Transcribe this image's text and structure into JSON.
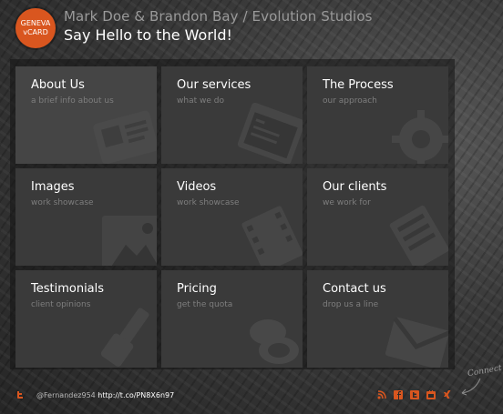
{
  "brand": {
    "logo_line1": "GENEVA",
    "logo_line2": "vCARD",
    "accent": "#d9561f"
  },
  "header": {
    "title": "Mark Doe & Brandon Bay / Evolution Studios",
    "subtitle": "Say Hello to the World!"
  },
  "tiles": [
    {
      "title": "About Us",
      "subtitle": "a brief info about us",
      "icon": "id-card-icon"
    },
    {
      "title": "Our services",
      "subtitle": "what we do",
      "icon": "browser-window-icon"
    },
    {
      "title": "The Process",
      "subtitle": "our approach",
      "icon": "gear-icon"
    },
    {
      "title": "Images",
      "subtitle": "work showcase",
      "icon": "image-icon"
    },
    {
      "title": "Videos",
      "subtitle": "work showcase",
      "icon": "film-icon"
    },
    {
      "title": "Our clients",
      "subtitle": "we work for",
      "icon": "clients-icon"
    },
    {
      "title": "Testimonials",
      "subtitle": "client opinions",
      "icon": "brush-icon"
    },
    {
      "title": "Pricing",
      "subtitle": "get the quota",
      "icon": "coins-icon"
    },
    {
      "title": "Contact us",
      "subtitle": "drop us a line",
      "icon": "envelope-icon"
    }
  ],
  "footer": {
    "handle": "@Fernandez954",
    "link": "http://t.co/PN8X6n97",
    "connect_label": "Connect",
    "social_icons": [
      "rss-icon",
      "facebook-icon",
      "twitter-icon",
      "youtube-icon",
      "xing-icon"
    ]
  }
}
